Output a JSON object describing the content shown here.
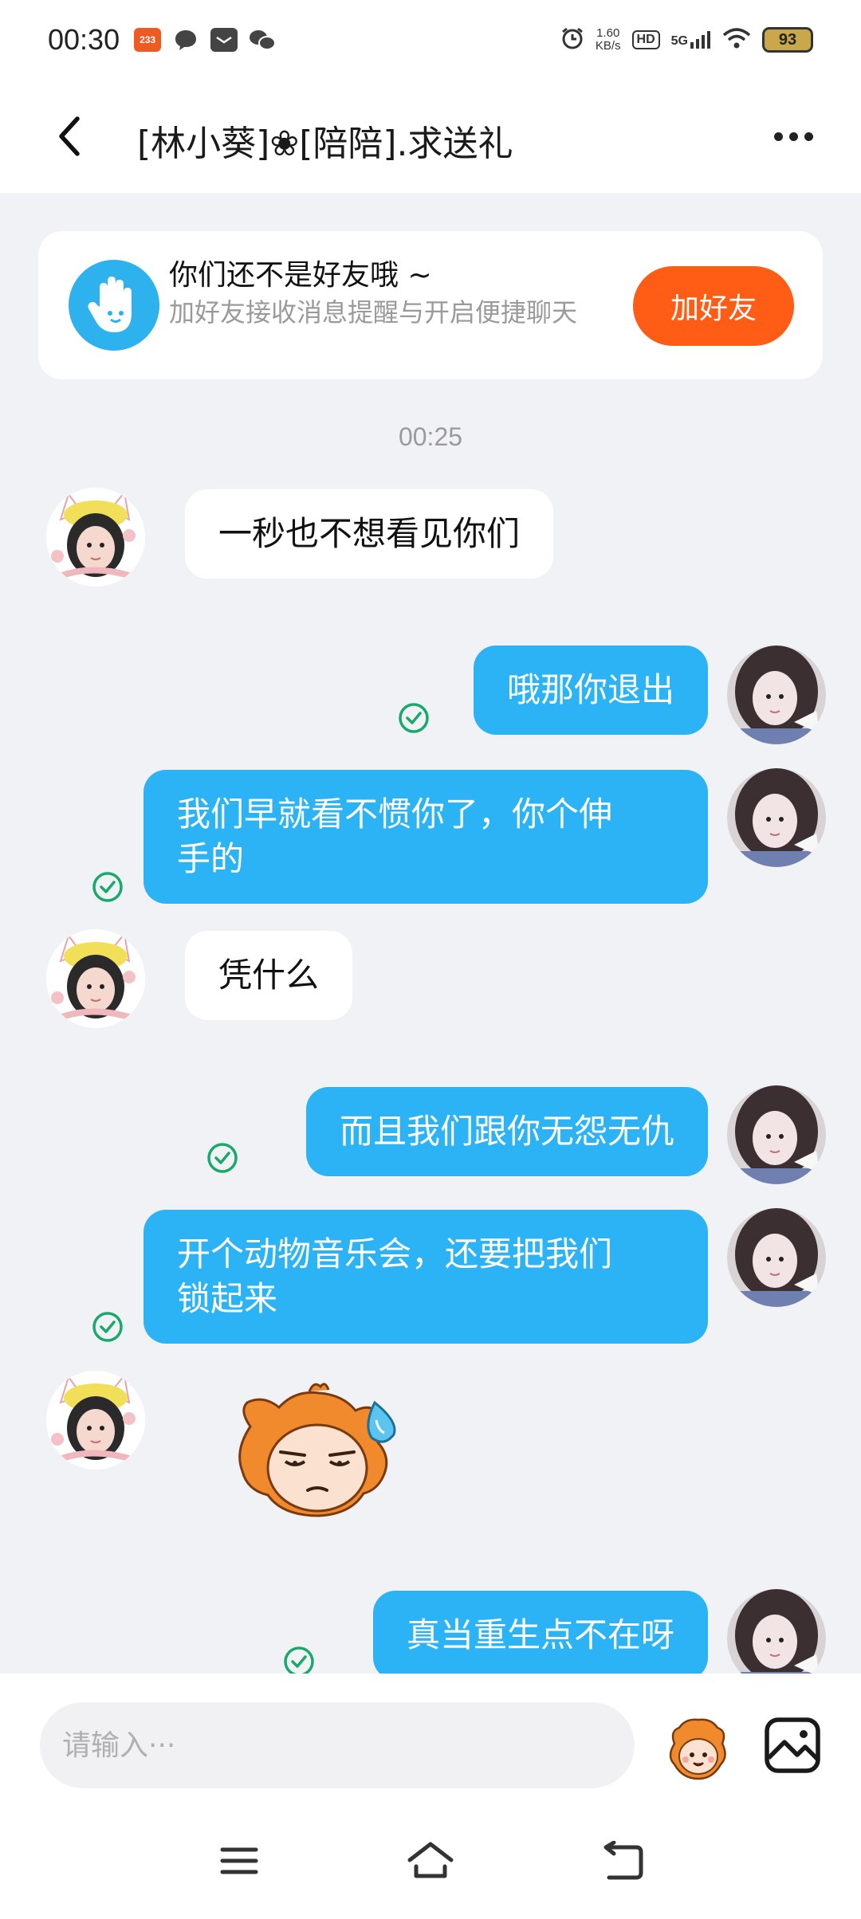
{
  "status_bar": {
    "time": "00:30",
    "app_badge": "233",
    "net_speed_value": "1.60",
    "net_speed_unit": "KB/s",
    "hd": "HD",
    "network": "5G",
    "battery": "93"
  },
  "header": {
    "title": "[林小葵]❀[陪陪].求送礼"
  },
  "friend_card": {
    "title": "你们还不是好友哦 ~",
    "subtitle": "加好友接收消息提醒与开启便捷聊天",
    "button": "加好友"
  },
  "chat": {
    "timestamp": "00:25",
    "messages": [
      {
        "side": "in",
        "text": "一秒也不想看见你们"
      },
      {
        "side": "out",
        "text": "哦那你退出"
      },
      {
        "side": "out",
        "text": "我们早就看不惯你了，你个伸\n手的"
      },
      {
        "side": "in",
        "text": "凭什么"
      },
      {
        "side": "out",
        "text": "而且我们跟你无怨无仇"
      },
      {
        "side": "out",
        "text": "开个动物音乐会，还要把我们\n锁起来"
      },
      {
        "side": "in",
        "sticker": "speechless-sweat-sticker"
      },
      {
        "side": "out",
        "text": "真当重生点不在呀"
      }
    ]
  },
  "input": {
    "placeholder": "请输入···"
  },
  "icons": {
    "back": "chevron-left-icon",
    "more": "more-horizontal-icon",
    "friend": "hand-icon",
    "read": "check-circle-icon",
    "emoji": "cartoon-face-icon",
    "image": "image-icon",
    "nav_menu": "menu-icon",
    "nav_home": "home-icon",
    "nav_back": "return-icon"
  },
  "colors": {
    "accent_blue": "#2bb3f5",
    "add_friend_orange": "#ff5c16",
    "read_tick_green": "#1aa86b",
    "background": "#f1f2f6"
  }
}
